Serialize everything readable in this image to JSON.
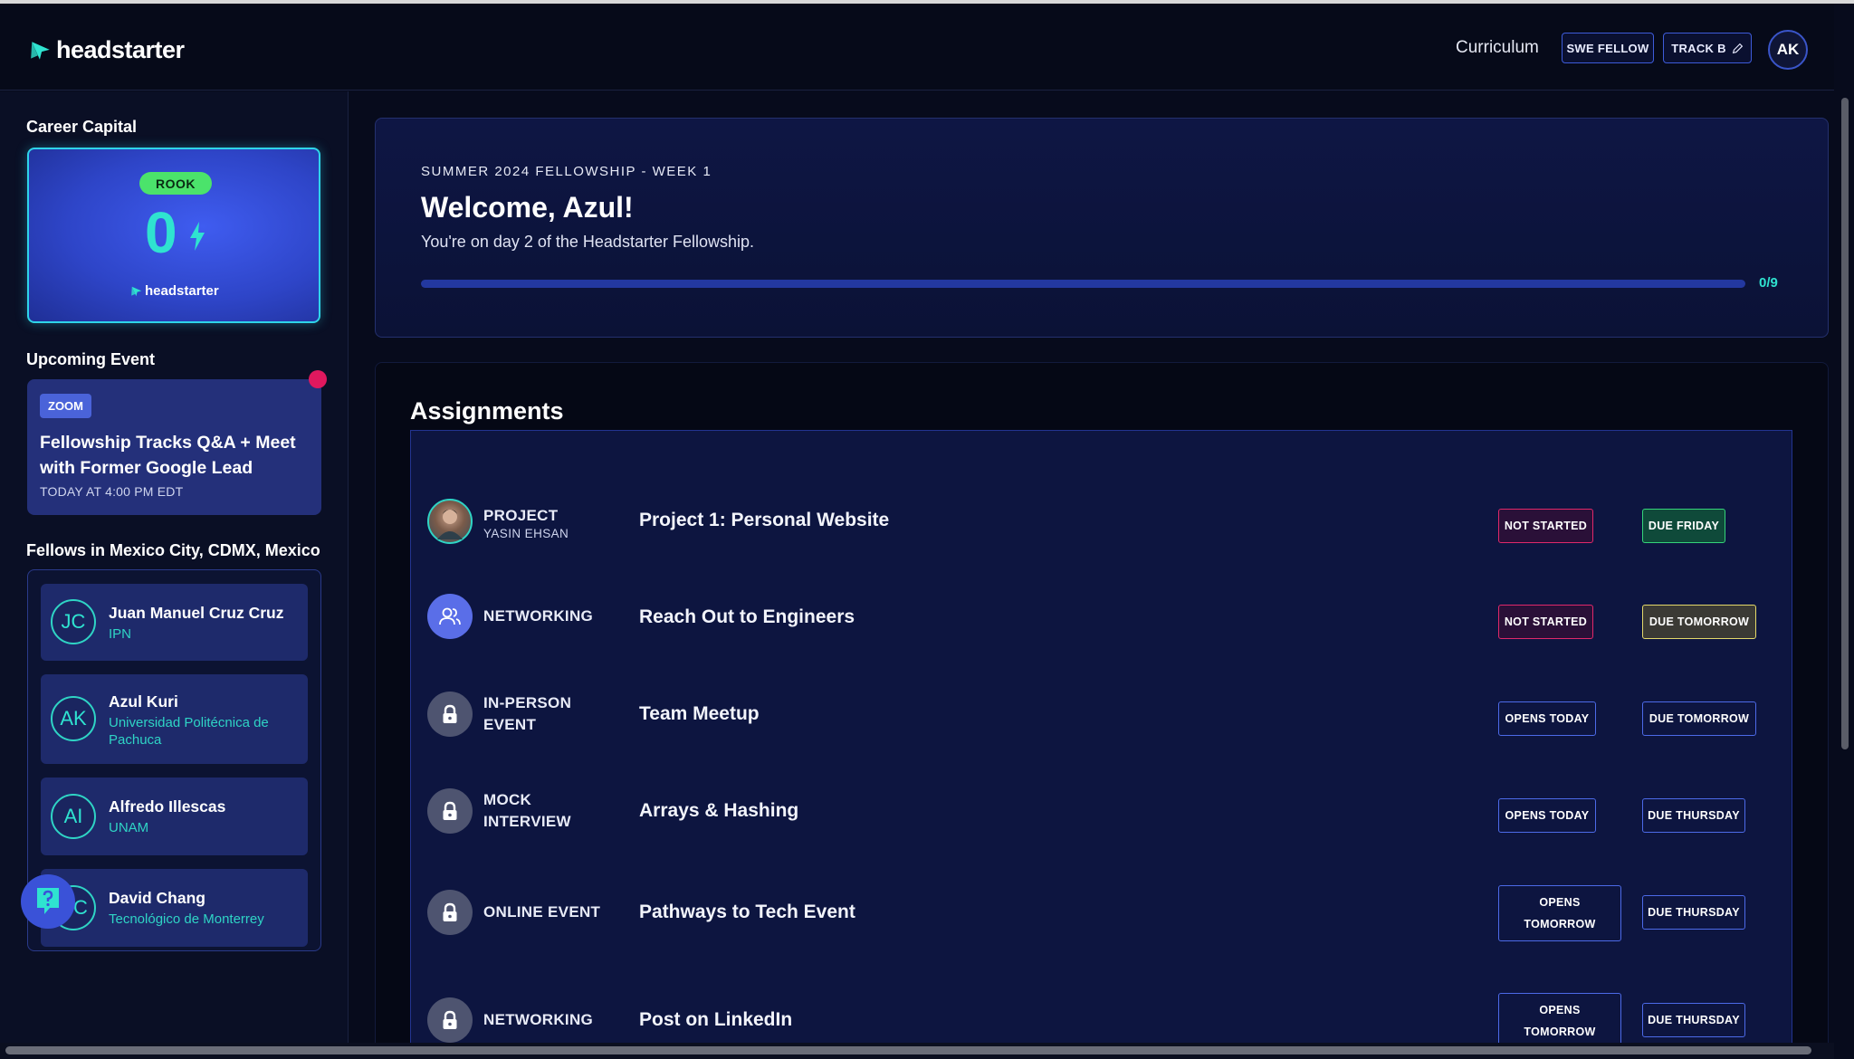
{
  "colors": {
    "background": "#070b1c",
    "accent_teal": "#2fe3d0",
    "accent_blue": "#3d5bd9",
    "not_started": "#e0286a",
    "due_green": "#35d47a",
    "due_yellow": "#e4d96a",
    "rook_green": "#4be36b"
  },
  "header": {
    "logo_text": "headstarter",
    "nav_curriculum": "Curriculum",
    "swe_fellow_label": "SWE FELLOW",
    "track_label": "TRACK B",
    "avatar_initials": "AK"
  },
  "sidebar": {
    "career_capital": {
      "heading": "Career Capital",
      "rank": "ROOK",
      "score": "0",
      "brand": "headstarter"
    },
    "upcoming_event": {
      "heading": "Upcoming Event",
      "platform": "ZOOM",
      "title": "Fellowship Tracks Q&A + Meet with Former Google Lead",
      "time": "TODAY AT 4:00 PM EDT"
    },
    "fellows": {
      "heading": "Fellows in Mexico City, CDMX, Mexico",
      "items": [
        {
          "initials": "JC",
          "name": "Juan Manuel Cruz Cruz",
          "school": "IPN"
        },
        {
          "initials": "AK",
          "name": "Azul Kuri",
          "school": "Universidad Politécnica de Pachuca"
        },
        {
          "initials": "AI",
          "name": "Alfredo Illescas",
          "school": "UNAM"
        },
        {
          "initials": "DC",
          "name": "David Chang",
          "school": "Tecnológico de Monterrey"
        }
      ]
    }
  },
  "welcome": {
    "kicker": "SUMMER 2024 FELLOWSHIP - WEEK 1",
    "title": "Welcome, Azul!",
    "subtitle": "You're on day 2 of the Headstarter Fellowship.",
    "progress_label": "0/9",
    "progress_fraction": 0
  },
  "assignments": {
    "heading": "Assignments",
    "rows": [
      {
        "type": "PROJECT",
        "type_sub": "YASIN EHSAN",
        "title": "Project 1: Personal Website",
        "status": "NOT STARTED",
        "due": "DUE FRIDAY",
        "icon": "mentor-avatar"
      },
      {
        "type": "NETWORKING",
        "type_sub": "",
        "title": "Reach Out to Engineers",
        "status": "NOT STARTED",
        "due": "DUE TOMORROW",
        "icon": "people-icon"
      },
      {
        "type": "IN-PERSON EVENT",
        "type_sub": "",
        "title": "Team Meetup",
        "status": "OPENS TODAY",
        "due": "DUE TOMORROW",
        "icon": "lock-icon"
      },
      {
        "type": "MOCK INTERVIEW",
        "type_sub": "",
        "title": "Arrays & Hashing",
        "status": "OPENS TODAY",
        "due": "DUE THURSDAY",
        "icon": "lock-icon"
      },
      {
        "type": "ONLINE EVENT",
        "type_sub": "",
        "title": "Pathways to Tech Event",
        "status": "OPENS TOMORROW",
        "due": "DUE THURSDAY",
        "icon": "lock-icon"
      },
      {
        "type": "NETWORKING",
        "type_sub": "",
        "title": "Post on LinkedIn",
        "status": "OPENS TOMORROW",
        "due": "DUE THURSDAY",
        "icon": "lock-icon"
      }
    ]
  }
}
